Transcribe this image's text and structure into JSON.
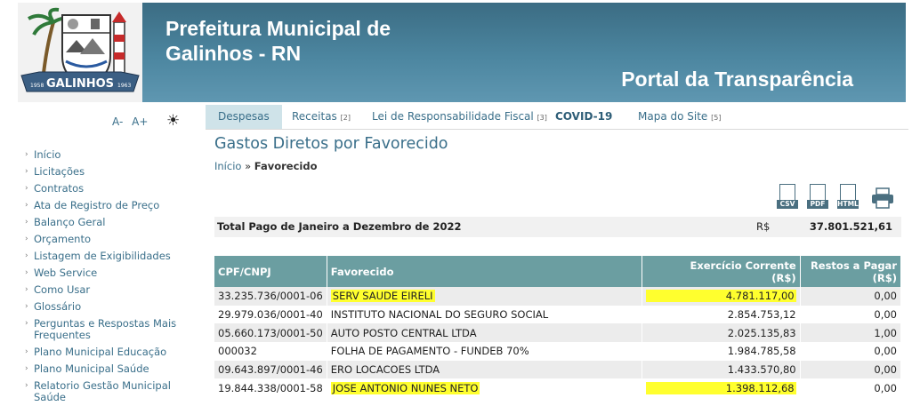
{
  "header": {
    "logo_text": "GALINHOS",
    "logo_year_left": "1958",
    "logo_year_right": "1963",
    "site_title_line1": "Prefeitura Municipal de",
    "site_title_line2": "Galinhos - RN",
    "portal_title": "Portal da Transparência"
  },
  "font_controls": {
    "decrease": "A-",
    "increase": "A+",
    "contrast_icon": "☀"
  },
  "sidebar": {
    "items": [
      {
        "label": "Início"
      },
      {
        "label": "Licitações"
      },
      {
        "label": "Contratos"
      },
      {
        "label": "Ata de Registro de Preço"
      },
      {
        "label": "Balanço Geral"
      },
      {
        "label": "Orçamento"
      },
      {
        "label": "Listagem de Exigibilidades"
      },
      {
        "label": "Web Service"
      },
      {
        "label": "Como Usar"
      },
      {
        "label": "Glossário"
      },
      {
        "label": "Perguntas e Respostas Mais Frequentes"
      },
      {
        "label": "Plano Municipal Educação"
      },
      {
        "label": "Plano Municipal Saúde"
      },
      {
        "label": "Relatorio Gestão Municipal Saúde"
      }
    ]
  },
  "tabs": [
    {
      "label": "Despesas",
      "count": ""
    },
    {
      "label": "Receitas",
      "count": "[2]"
    },
    {
      "label": "Lei de Responsabilidade Fiscal",
      "count": "[3]"
    },
    {
      "label": "COVID-19",
      "count": ""
    },
    {
      "label": "Mapa do Site",
      "count": "[5]"
    }
  ],
  "main": {
    "page_title": "Gastos Diretos por Favorecido",
    "breadcrumb": {
      "home": "Início",
      "separator": "»",
      "current": "Favorecido"
    },
    "export": {
      "csv": "CSV",
      "pdf": "PDF",
      "html": "HTML"
    },
    "total": {
      "label": "Total Pago de Janeiro a Dezembro de 2022",
      "currency": "R$",
      "value": "37.801.521,61"
    },
    "table": {
      "headers": {
        "cpf": "CPF/CNPJ",
        "favorecido": "Favorecido",
        "exercicio": "Exercício Corrente",
        "exercicio_unit": "(R$)",
        "restos": "Restos a Pagar",
        "restos_unit": "(R$)"
      },
      "rows": [
        {
          "cpf": "33.235.736/0001-06",
          "name": "SERV SAUDE EIRELI",
          "current": "4.781.117,00",
          "restos": "0,00"
        },
        {
          "cpf": "29.979.036/0001-40",
          "name": "INSTITUTO NACIONAL DO SEGURO SOCIAL",
          "current": "2.854.753,12",
          "restos": "0,00"
        },
        {
          "cpf": "05.660.173/0001-50",
          "name": "AUTO POSTO CENTRAL LTDA",
          "current": "2.025.135,83",
          "restos": "1,00"
        },
        {
          "cpf": "000032",
          "name": "FOLHA DE PAGAMENTO - FUNDEB 70%",
          "current": "1.984.785,58",
          "restos": "0,00"
        },
        {
          "cpf": "09.643.897/0001-46",
          "name": "ERO LOCACOES LTDA",
          "current": "1.433.570,80",
          "restos": "0,00"
        },
        {
          "cpf": "19.844.338/0001-58",
          "name": "JOSE ANTONIO NUNES NETO",
          "current": "1.398.112,68",
          "restos": "0,00"
        }
      ]
    }
  },
  "colors": {
    "banner": "#4c86a0",
    "table_header": "#6b9ea1",
    "link": "#3a6f8a",
    "highlight": "#ffff2e"
  }
}
